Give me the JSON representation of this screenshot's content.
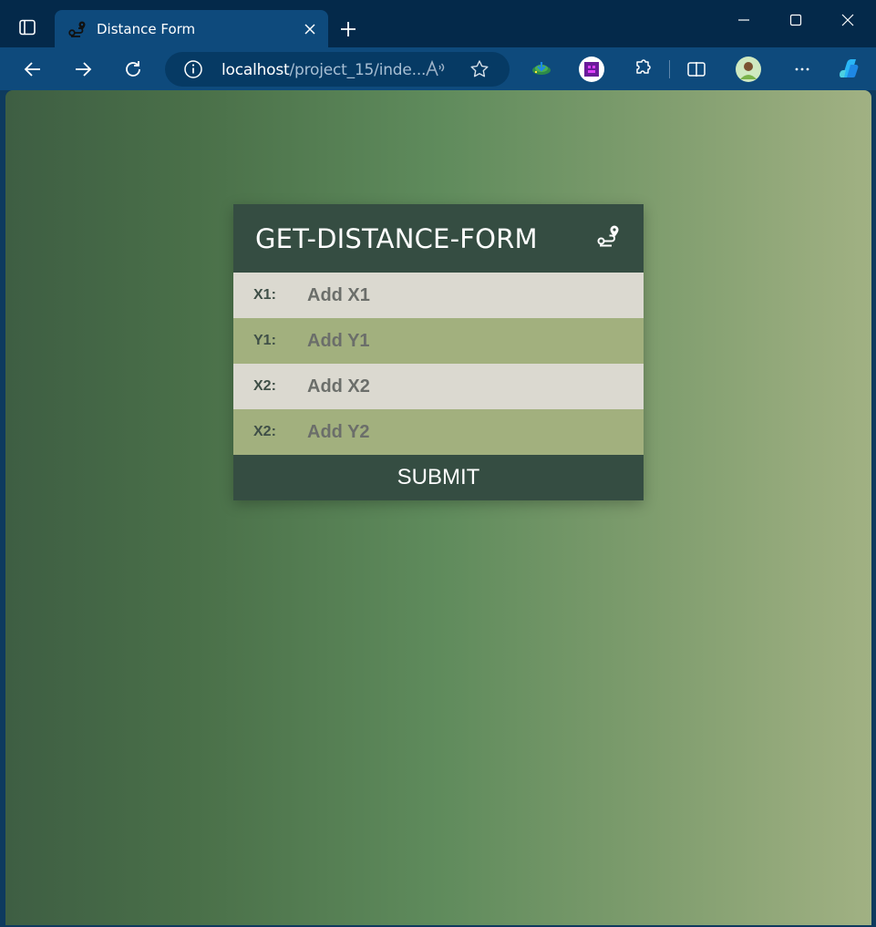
{
  "browser": {
    "tab": {
      "title": "Distance Form"
    },
    "address": {
      "host": "localhost",
      "path": "/project_15/inde..."
    }
  },
  "form": {
    "title": "GET-DISTANCE-FORM",
    "fields": [
      {
        "label": "X1:",
        "placeholder": "Add X1",
        "value": ""
      },
      {
        "label": "Y1:",
        "placeholder": "Add Y1",
        "value": ""
      },
      {
        "label": "X2:",
        "placeholder": "Add X2",
        "value": ""
      },
      {
        "label": "X2:",
        "placeholder": "Add Y2",
        "value": ""
      }
    ],
    "submit_label": "SUBMIT"
  },
  "colors": {
    "header": "#354d42",
    "row_light": "#dbd9d0",
    "row_green": "#a2b07e",
    "chrome_dark": "#04294a",
    "chrome_tab": "#0e4a7c"
  },
  "icons": {
    "tab_favicon": "route-icon",
    "form_header": "route-icon"
  }
}
